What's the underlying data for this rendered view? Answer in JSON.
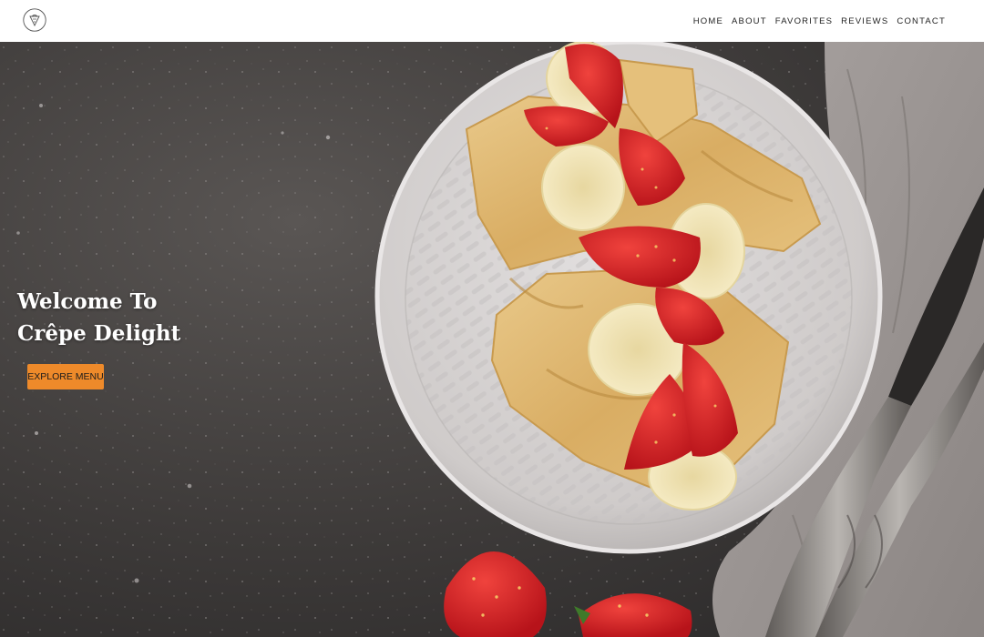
{
  "brand": {
    "logo_icon": "crepe-logo-icon"
  },
  "nav": {
    "items": [
      {
        "label": "HOME"
      },
      {
        "label": "ABOUT"
      },
      {
        "label": "FAVORITES"
      },
      {
        "label": "REVIEWS"
      },
      {
        "label": "CONTACT"
      }
    ]
  },
  "hero": {
    "title_line1": "Welcome To",
    "title_line2": "Crêpe Delight",
    "cta_label": "EXPLORE MENU",
    "image_subject": "crepes-with-strawberries-and-bananas-photo"
  },
  "colors": {
    "accent": "#ee8a2a",
    "header_bg": "#ffffff",
    "nav_text": "#222222",
    "title_text": "#ffffff"
  }
}
